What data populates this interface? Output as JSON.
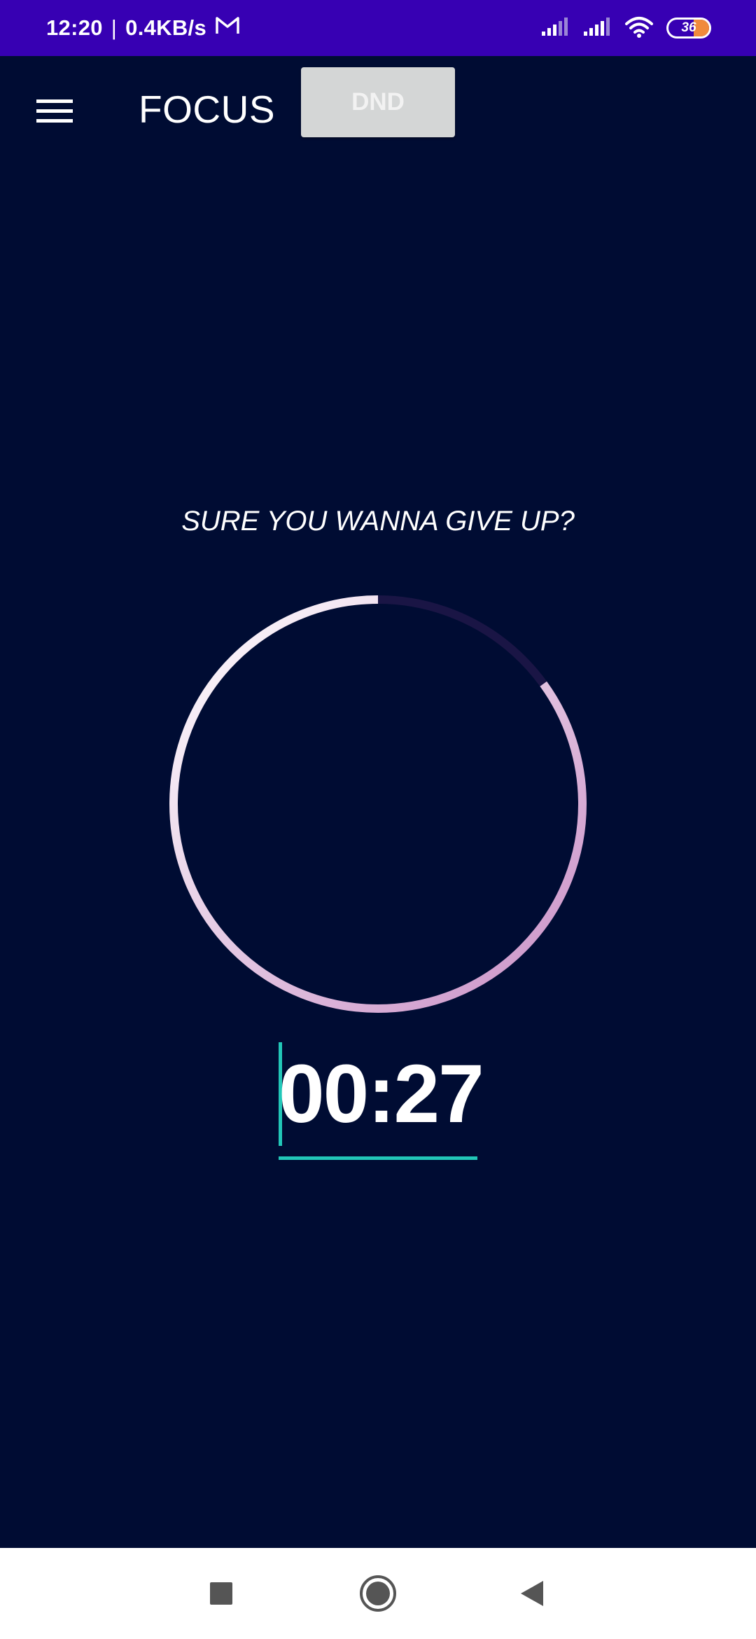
{
  "status_bar": {
    "time": "12:20",
    "separator": "|",
    "network_speed": "0.4KB/s",
    "battery_level": "36"
  },
  "app_bar": {
    "title": "FOCUS",
    "dnd_label": "DND"
  },
  "session": {
    "prompt": "SURE YOU WANNA GIVE UP?",
    "timer": "00:27",
    "ring_progress": 0.85
  },
  "colors": {
    "status_bar_bg": "#3700b3",
    "background": "#000c33",
    "accent": "#22c7b8",
    "ring_start": "#c98fc6",
    "ring_end": "#ffffff"
  },
  "icons": {
    "menu": "hamburger-menu-icon",
    "mail": "gmail-icon",
    "signal": "cell-signal-icon",
    "wifi": "wifi-icon",
    "nav_recents": "square-icon",
    "nav_home": "circle-icon",
    "nav_back": "triangle-back-icon"
  }
}
